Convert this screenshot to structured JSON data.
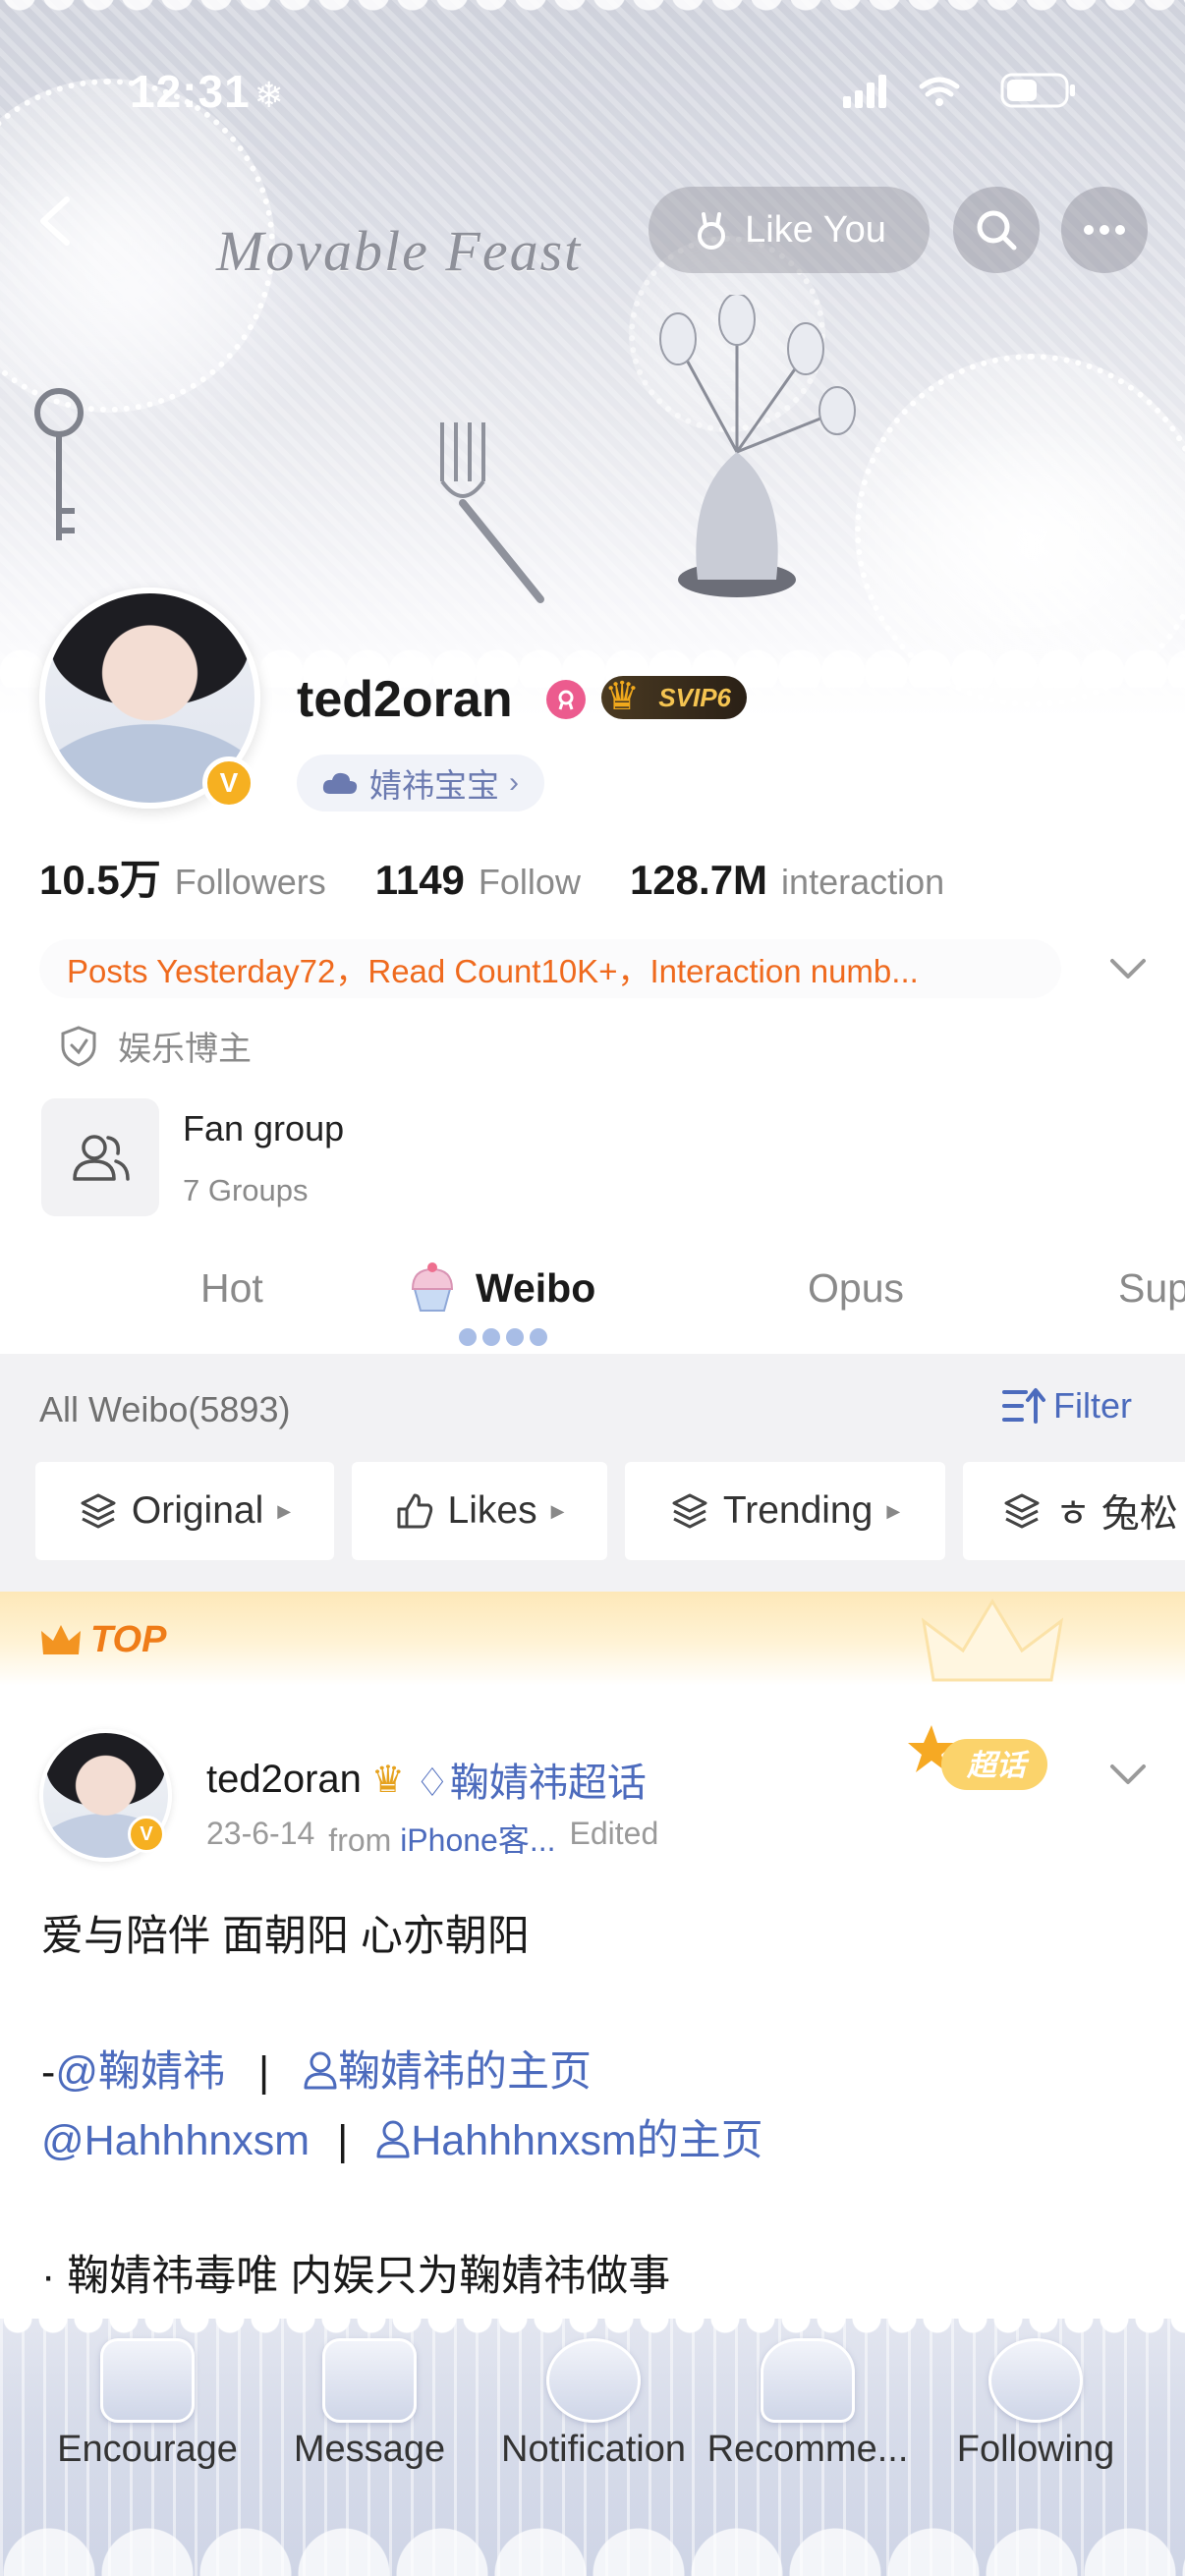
{
  "status_bar": {
    "time": "12:31",
    "snow_glyph": "❄"
  },
  "banner": {
    "art_title": "Movable Feast"
  },
  "top_nav": {
    "like_you_label": "Like You"
  },
  "profile": {
    "username": "ted2oran",
    "verified_glyph": "V",
    "svip_label": "SVIP6",
    "fan_tag": "婧祎宝宝",
    "stats": {
      "followers_value": "10.5万",
      "followers_label": "Followers",
      "follow_value": "1149",
      "follow_label": "Follow",
      "interaction_value": "128.7M",
      "interaction_label": "interaction"
    },
    "notice": "Posts Yesterday72，Read Count10K+，Interaction numb...",
    "certification": "娱乐博主",
    "fan_group": {
      "title": "Fan group",
      "subtitle": "7 Groups"
    }
  },
  "tabs": [
    {
      "label": "Hot"
    },
    {
      "label": "Weibo"
    },
    {
      "label": "Opus"
    },
    {
      "label": "Sup"
    }
  ],
  "feed": {
    "all_weibo": "All Weibo(5893)",
    "filter_label": "Filter",
    "chips": [
      {
        "label": "Original"
      },
      {
        "label": "Likes"
      },
      {
        "label": "Trending"
      },
      {
        "label": "ㅎ 兔松"
      }
    ],
    "top_label": "TOP"
  },
  "post": {
    "author": "ted2oran",
    "topic": "鞠婧祎超话",
    "date": "23-6-14",
    "from": "from",
    "source": "iPhone客...",
    "edited": "Edited",
    "chaohua_badge": "超话",
    "line1": "爱与陪伴 面朝阳 心亦朝阳",
    "line2_prefix": "-",
    "line2_mention": "@鞠婧祎",
    "separator": "|",
    "line2_link": "鞠婧祎的主页",
    "line3_mention": "@Hahhhnxsm",
    "line3_link": "Hahhhnxsm的主页",
    "line4": "· 鞠婧祎毒唯 内娱只为鞠婧祎做事"
  },
  "bottom_nav": [
    {
      "label": "Encourage"
    },
    {
      "label": "Message"
    },
    {
      "label": "Notification"
    },
    {
      "label": "Recomme..."
    },
    {
      "label": "Following"
    }
  ],
  "colors": {
    "link_blue": "#4c6bbd",
    "notice_orange": "#ef6a1e",
    "verified_gold": "#f6b021",
    "top_orange": "#ef7c18"
  }
}
